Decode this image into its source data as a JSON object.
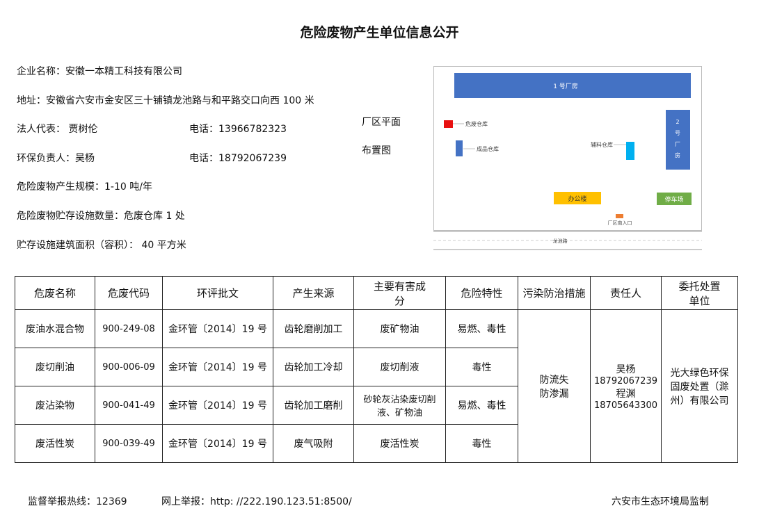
{
  "title": "危险废物产生单位信息公开",
  "info": {
    "company": "企业名称：安徽一本精工科技有限公司",
    "address": "地址：安徽省六安市金安区三十铺镇龙池路与和平路交口向西 100 米",
    "legal_rep": "法人代表：  贾树伦",
    "legal_phone": "电话：13966782323",
    "env_manager": "环保负责人：吴杨",
    "env_phone": "电话：18792067239",
    "scale": "危险废物产生规模：1-10 吨/年",
    "facility_count": "危险废物贮存设施数量：危废仓库 1 处",
    "facility_area": "贮存设施建筑面积（容积）： 40 平方米"
  },
  "plan": {
    "label_line1": "厂区平面",
    "label_line2": "布置图",
    "building1": "1 号厂房",
    "hazard_store": "危废仓库",
    "product_store": "成品仓库",
    "aux_store": "辅料仓库",
    "building2_chars": [
      "2",
      "号",
      "厂",
      "房"
    ],
    "office": "办公楼",
    "parking": "停车场",
    "gate": "厂区南入口",
    "road": "龙池路",
    "colors": {
      "building": "#4472c4",
      "hazard": "#e81010",
      "aux": "#00b0f0",
      "office": "#ffc000",
      "parking": "#70ad47",
      "gate": "#ed7d31"
    }
  },
  "table": {
    "headers": [
      "危废名称",
      "危废代码",
      "环评批文",
      "产生来源",
      "主要有害成分",
      "危险特性",
      "污染防治措施",
      "责任人",
      "委托处置单位"
    ],
    "rows": [
      {
        "name": "废油水混合物",
        "code": "900-249-08",
        "approval": "金环管〔2014〕19 号",
        "source": "齿轮磨削加工",
        "component": "废矿物油",
        "property": "易燃、毒性"
      },
      {
        "name": "废切削油",
        "code": "900-006-09",
        "approval": "金环管〔2014〕19 号",
        "source": "齿轮加工冷却",
        "component": "废切削液",
        "property": "毒性"
      },
      {
        "name": "废沾染物",
        "code": "900-041-49",
        "approval": "金环管〔2014〕19 号",
        "source": "齿轮加工磨削",
        "component": "砂轮灰沾染废切削液、矿物油",
        "property": "易燃、毒性"
      },
      {
        "name": "废活性炭",
        "code": "900-039-49",
        "approval": "金环管〔2014〕19 号",
        "source": "废气吸附",
        "component": "废活性炭",
        "property": "毒性"
      }
    ],
    "measures": [
      "防流失",
      "防渗漏"
    ],
    "responsible": [
      "吴杨",
      "18792067239",
      "程渊",
      "18705643300"
    ],
    "disposal": "光大绿色环保固废处置（滁州）有限公司"
  },
  "footer": {
    "hotline": "监督举报热线：12369",
    "online": "网上举报：http: //222.190.123.51:8500/",
    "supervisor": "六安市生态环境局监制"
  }
}
